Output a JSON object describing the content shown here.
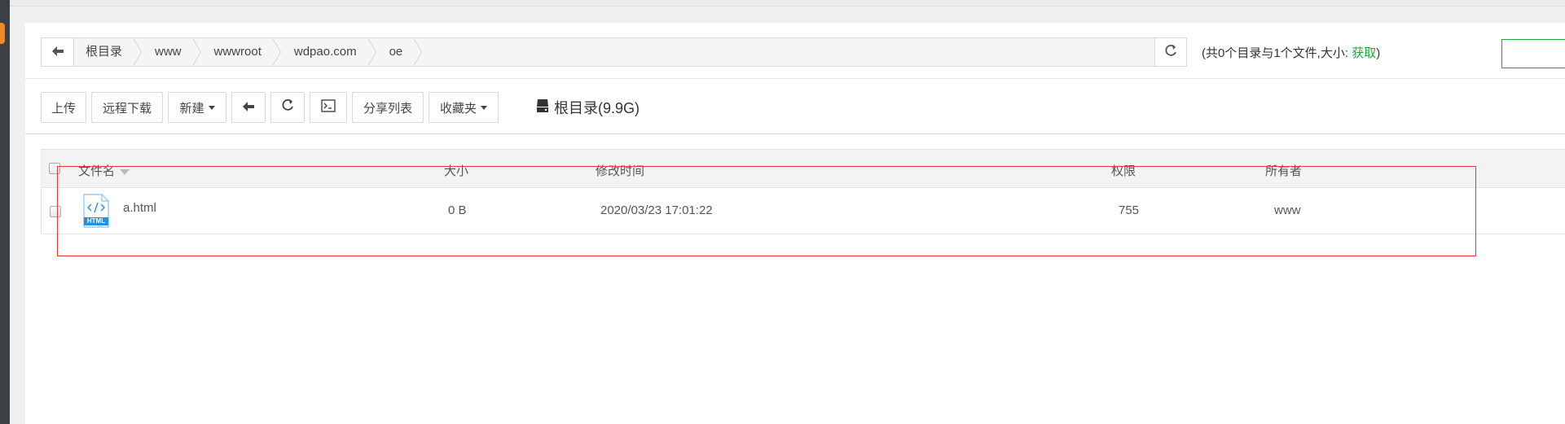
{
  "path_bar": {
    "crumbs": [
      "根目录",
      "www",
      "wwwroot",
      "wdpao.com",
      "oe"
    ]
  },
  "summary": {
    "prefix": "(共0个目录与1个文件,大小: ",
    "fetch_label": "获取",
    "suffix": ")"
  },
  "toolbar": {
    "upload_label": "上传",
    "remote_download_label": "远程下载",
    "new_label": "新建",
    "share_list_label": "分享列表",
    "favorites_label": "收藏夹",
    "disk_label": "根目录(9.9G)"
  },
  "table": {
    "headers": {
      "name": "文件名",
      "size": "大小",
      "modified": "修改时间",
      "permissions": "权限",
      "owner": "所有者"
    },
    "rows": [
      {
        "name": "a.html",
        "size": "0 B",
        "modified": "2020/03/23 17:01:22",
        "permissions": "755",
        "owner": "www",
        "icon_label": "HTML"
      }
    ]
  },
  "colors": {
    "accent_green": "#20a53a",
    "highlight_red": "#e53935",
    "file_icon_blue": "#2b8fd6"
  },
  "icons": {
    "back": "arrow-left-icon",
    "refresh": "refresh-icon",
    "terminal": "terminal-icon",
    "disk": "hard-drive-icon",
    "file": "html-file-icon"
  }
}
